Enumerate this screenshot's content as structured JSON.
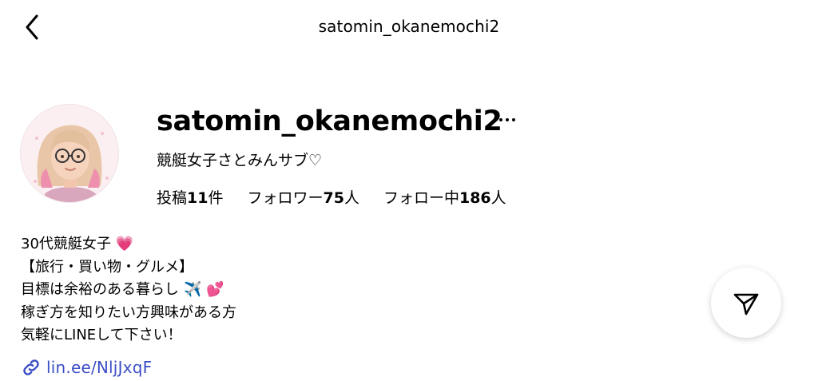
{
  "header": {
    "title": "satomin_okanemochi2",
    "back_icon": "chevron-left-icon"
  },
  "profile": {
    "username": "satomin_okanemochi2",
    "display_name": "競艇女子さとみんサブ♡",
    "avatar_icon": "memoji-avatar",
    "more_icon": "ellipsis-icon"
  },
  "stats": {
    "posts_label": "投稿",
    "posts_value": "11",
    "posts_unit": "件",
    "followers_label": "フォロワー",
    "followers_value": "75",
    "followers_unit": "人",
    "following_label": "フォロー中",
    "following_value": "186",
    "following_unit": "人"
  },
  "bio": {
    "lines": [
      "30代競艇女子",
      "【旅行・買い物・グルメ】",
      "目標は余裕のある暮らし",
      "稼ぎ方を知りたい方興味がある方",
      "気軽にLINEして下さい！"
    ],
    "emoji_heart": "💗",
    "emoji_airplane": "✈️",
    "emoji_hearts": "💕"
  },
  "link": {
    "text": "lin.ee/NljJxqF",
    "icon": "link-icon",
    "color": "#3b4ec6"
  },
  "actions": {
    "send_icon": "paper-plane-icon"
  }
}
